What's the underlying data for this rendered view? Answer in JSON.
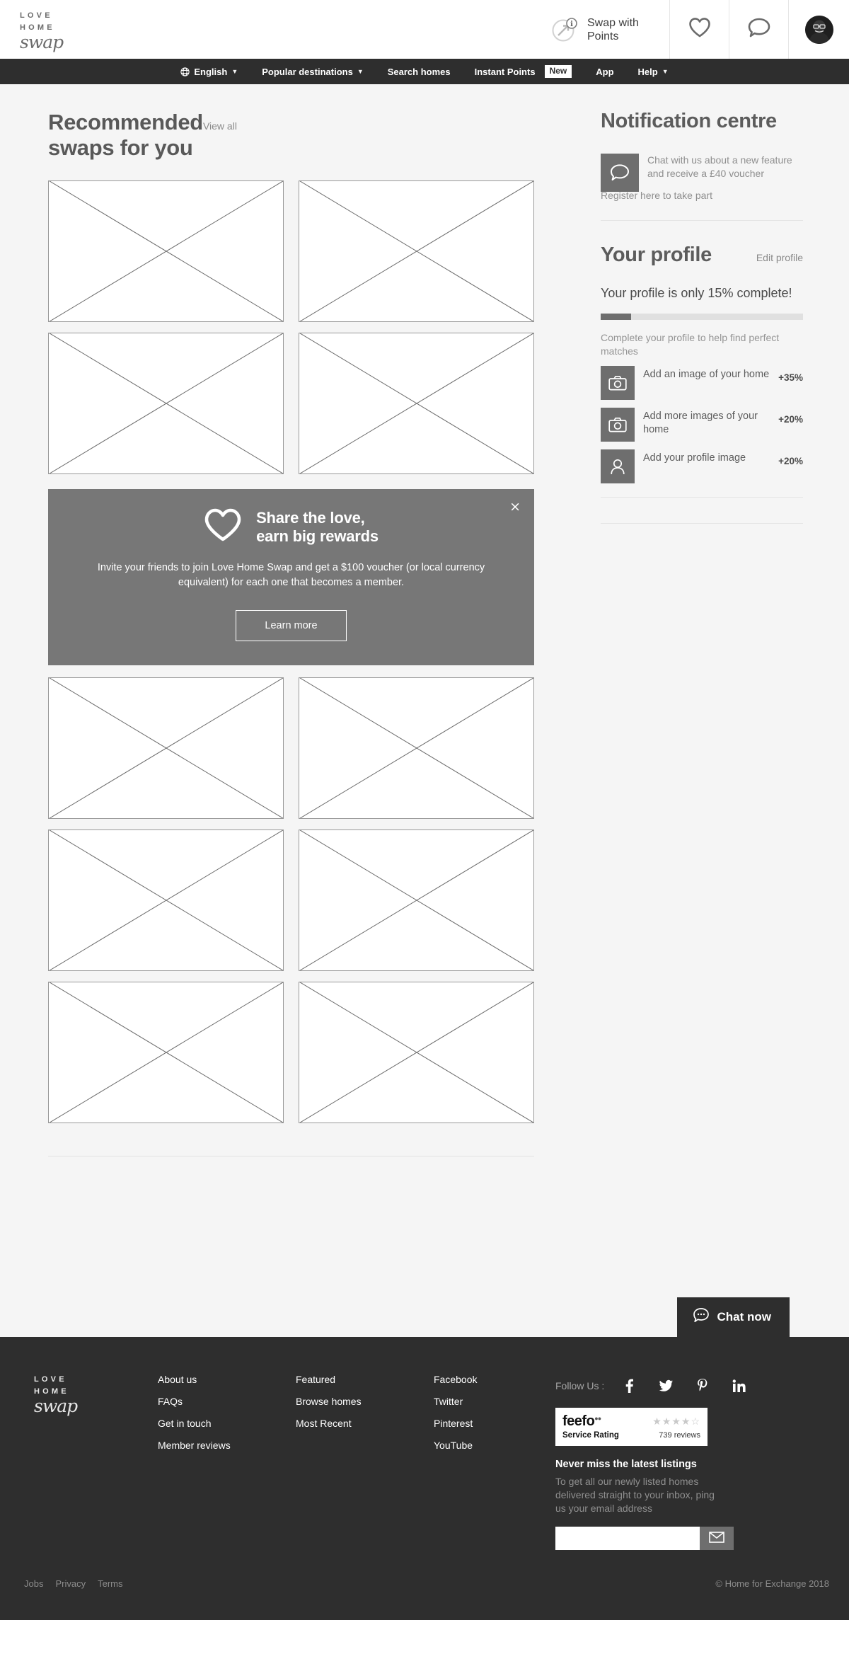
{
  "header": {
    "logo": {
      "line1": "LOVE",
      "line2": "HOME",
      "line3": "swap"
    },
    "swap_points_label": "Swap with Points",
    "icons": {
      "swap_points": "swap-points-icon",
      "wishlist": "heart-icon",
      "messages": "speech-bubble-icon",
      "account": "user-avatar"
    }
  },
  "nav": {
    "items": [
      {
        "label": "English",
        "icon": "globe-icon",
        "caret": true,
        "badge": null
      },
      {
        "label": "Popular destinations",
        "icon": null,
        "caret": true,
        "badge": null
      },
      {
        "label": "Search homes",
        "icon": null,
        "caret": false,
        "badge": null
      },
      {
        "label": "Instant Points",
        "icon": null,
        "caret": false,
        "badge": "New"
      },
      {
        "label": "App",
        "icon": null,
        "caret": false,
        "badge": null
      },
      {
        "label": "Help",
        "icon": null,
        "caret": true,
        "badge": null
      }
    ]
  },
  "main": {
    "section_title": "Recommended swaps for you",
    "view_all_label": "View all",
    "placeholder_count_top": 4,
    "placeholder_count_bottom": 6,
    "promo": {
      "title_line1": "Share the love,",
      "title_line2": "earn big rewards",
      "body": "Invite your friends to join Love Home Swap and get a $100 voucher (or local currency equivalent) for each one that becomes a member.",
      "button_label": "Learn more",
      "close_label": "×",
      "heart_icon": "heart-outline-icon",
      "background_color": "#777777"
    }
  },
  "sidebar": {
    "notification": {
      "title": "Notification centre",
      "message": "Chat with us about a new feature and receive a £40 voucher",
      "link_label": "Register here to take part",
      "icon": "speech-bubble-icon"
    },
    "profile": {
      "title": "Your profile",
      "edit_label": "Edit profile",
      "status_prefix": "Your profile is only ",
      "status_percent": "15%",
      "status_suffix": " complete!",
      "progress_percent": 15,
      "hint": "Complete your profile to help find perfect matches",
      "tasks": [
        {
          "label": "Add an image of your home",
          "value": "+35%",
          "icon": "camera-icon"
        },
        {
          "label": "Add more images of your home",
          "value": "+20%",
          "icon": "camera-icon"
        },
        {
          "label": "Add your profile image",
          "value": "+20%",
          "icon": "person-icon"
        }
      ]
    }
  },
  "chat_widget": {
    "label": "Chat now",
    "icon": "chat-bubble-dots-icon"
  },
  "footer": {
    "logo": {
      "line1": "LOVE",
      "line2": "HOME",
      "line3": "swap"
    },
    "columns": [
      {
        "links": [
          "About us",
          "FAQs",
          "Get in touch",
          "Member reviews"
        ]
      },
      {
        "links": [
          "Featured",
          "Browse homes",
          "Most Recent"
        ]
      },
      {
        "links": [
          "Facebook",
          "Twitter",
          "Pinterest",
          "YouTube"
        ]
      }
    ],
    "follow": {
      "label": "Follow Us :",
      "socials": [
        {
          "name": "facebook-icon",
          "glyph": "f"
        },
        {
          "name": "twitter-icon",
          "glyph": "t"
        },
        {
          "name": "pinterest-icon",
          "glyph": "P"
        },
        {
          "name": "linkedin-icon",
          "glyph": "in"
        }
      ]
    },
    "feefo": {
      "brand": "feefo",
      "service_rating": "Service Rating",
      "reviews": "739 reviews",
      "stars": "★★★★☆"
    },
    "newsletter": {
      "title": "Never miss the latest listings",
      "subtitle": "To get all our newly listed homes delivered straight to your inbox, ping us your email address",
      "input_value": "",
      "input_placeholder": "",
      "submit_icon": "envelope-icon"
    },
    "legal_links": [
      "Jobs",
      "Privacy",
      "Terms"
    ],
    "copyright": "© Home for Exchange 2018"
  }
}
